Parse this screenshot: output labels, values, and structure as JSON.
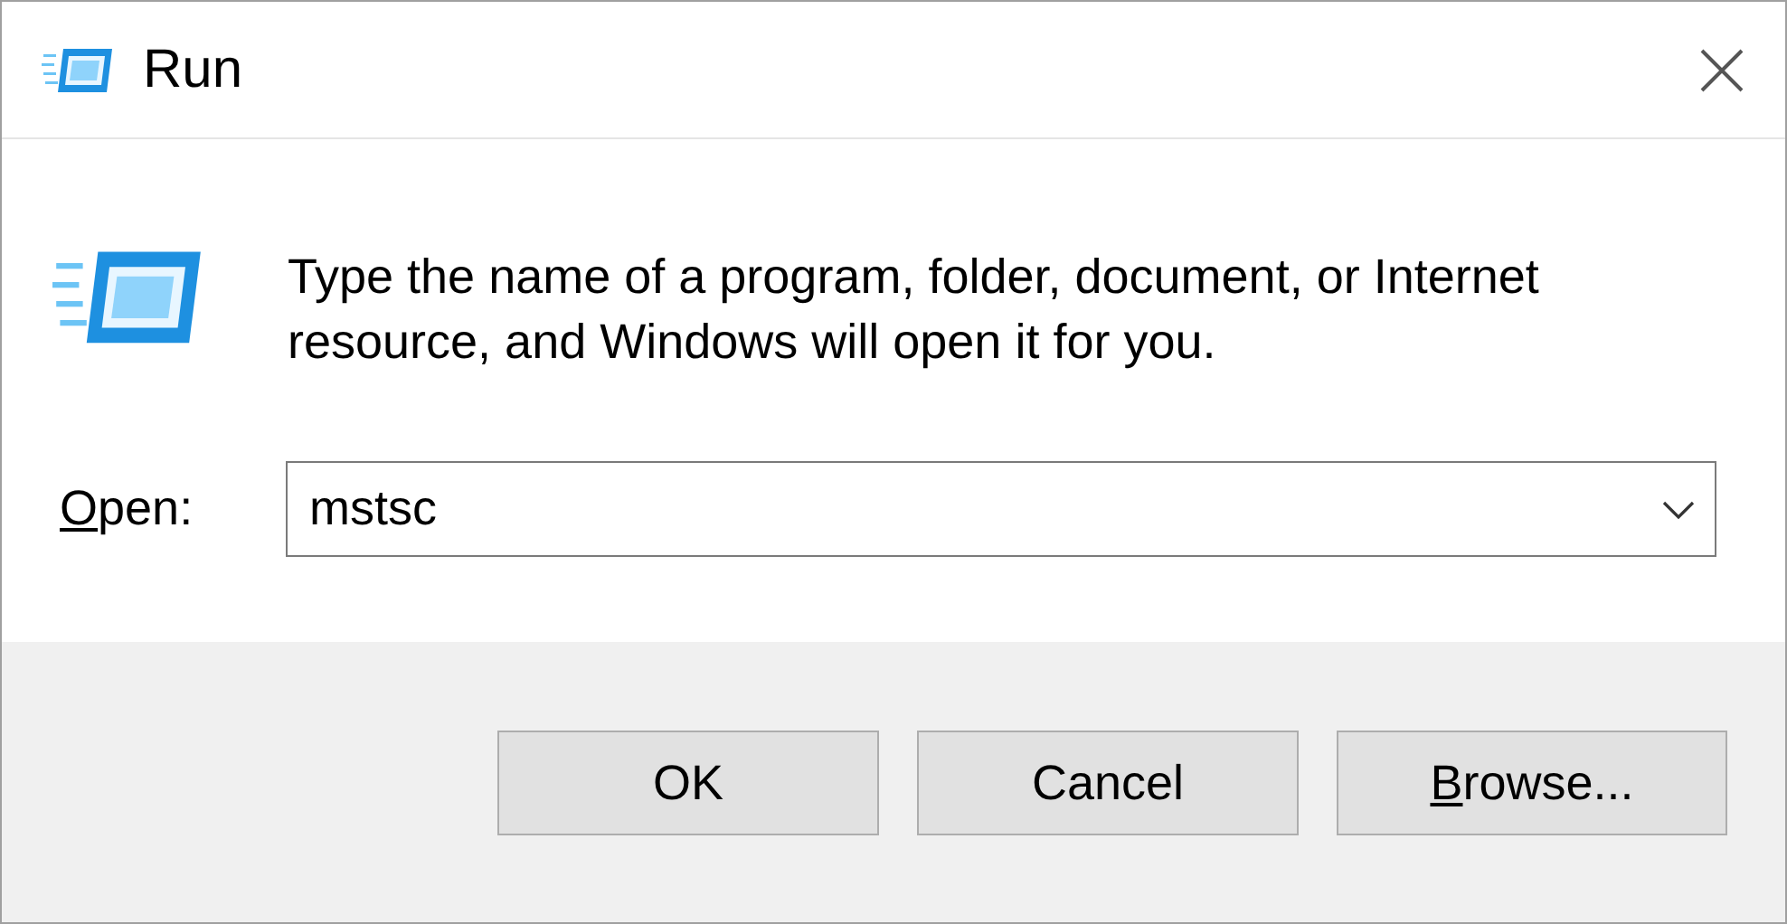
{
  "window": {
    "title": "Run"
  },
  "message": "Type the name of a program, folder, document, or Internet resource, and Windows will open it for you.",
  "open_field": {
    "label": "Open:",
    "value": "mstsc"
  },
  "buttons": [
    {
      "label": "OK",
      "access_key_underlined": false
    },
    {
      "label": "Cancel",
      "access_key_underlined": false
    },
    {
      "label": "Browse...",
      "access_key_underlined": true
    }
  ]
}
